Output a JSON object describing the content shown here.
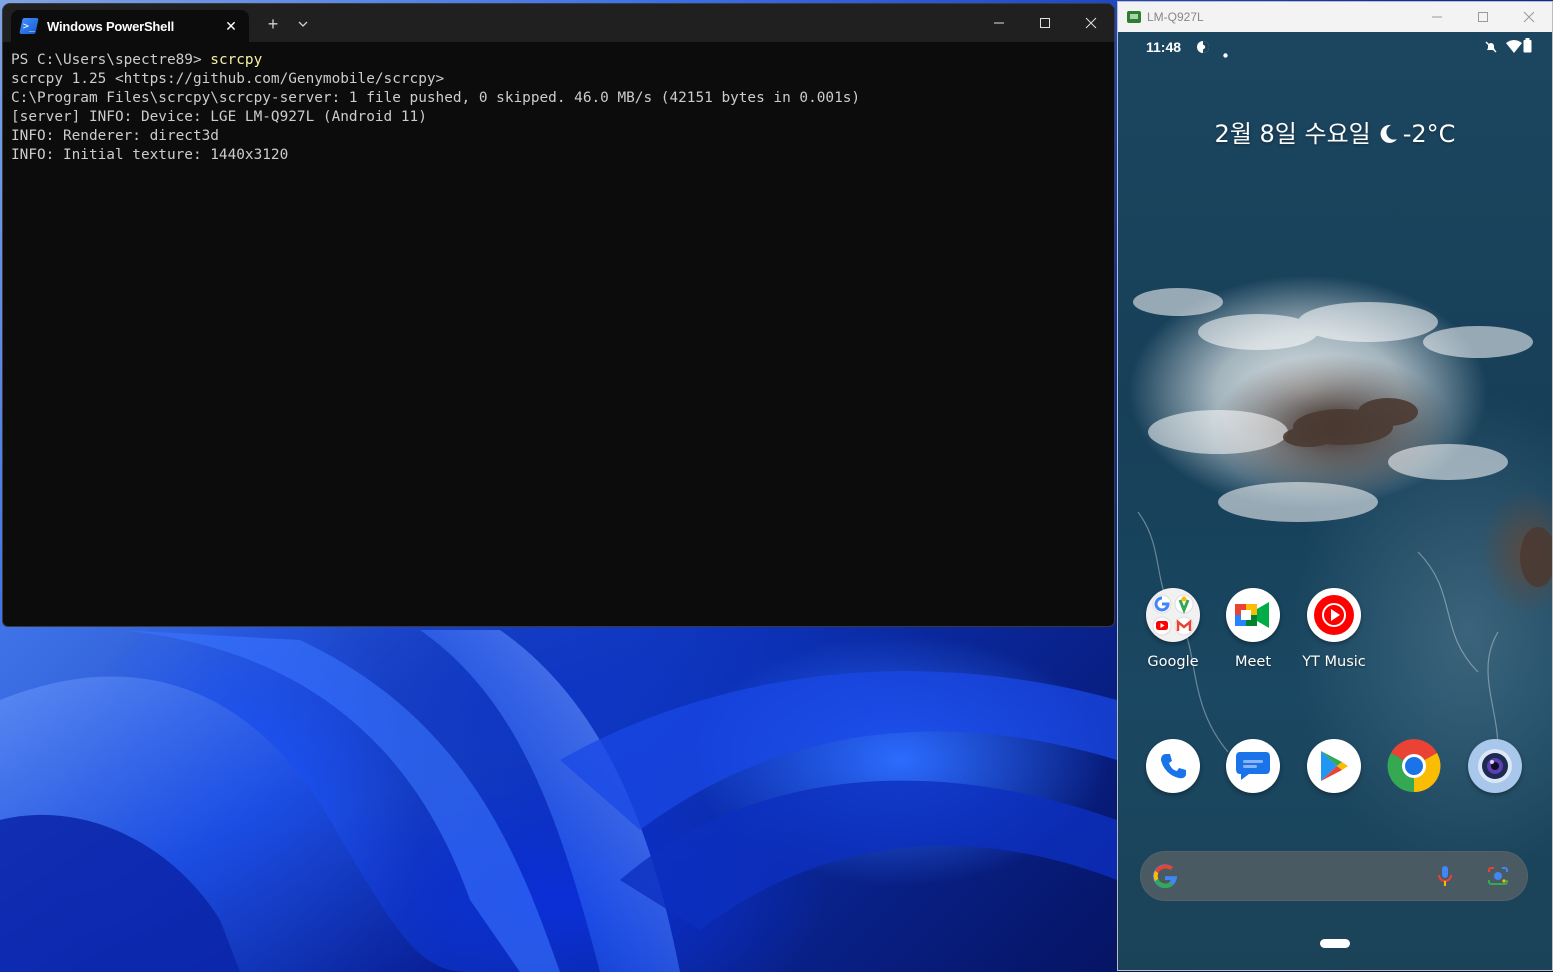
{
  "terminal": {
    "tab_title": "Windows PowerShell",
    "new_tab": "+",
    "lines": [
      {
        "prompt": "PS C:\\Users\\spectre89> ",
        "command": "scrcpy"
      },
      {
        "text": "scrcpy 1.25 <https://github.com/Genymobile/scrcpy>"
      },
      {
        "text": "C:\\Program Files\\scrcpy\\scrcpy-server: 1 file pushed, 0 skipped. 46.0 MB/s (42151 bytes in 0.001s)"
      },
      {
        "text": "[server] INFO: Device: LGE LM-Q927L (Android 11)"
      },
      {
        "text": "INFO: Renderer: direct3d"
      },
      {
        "text": "INFO: Initial texture: 1440x3120"
      }
    ]
  },
  "phone_window": {
    "title": "LM-Q927L",
    "status_bar": {
      "time": "11:48",
      "icons": [
        "data-saver-icon",
        "notification-dot-icon",
        "mute-icon",
        "wifi-icon",
        "battery-icon"
      ]
    },
    "glance": {
      "date": "2월 8일 수요일",
      "weather_icon": "moon-icon",
      "temperature": "-2°C"
    },
    "home_apps_row1": [
      {
        "label": "Google",
        "icon": "google-folder-icon"
      },
      {
        "label": "Meet",
        "icon": "meet-icon"
      },
      {
        "label": "YT Music",
        "icon": "yt-music-icon"
      }
    ],
    "dock_apps": [
      {
        "name": "Phone",
        "icon": "phone-icon"
      },
      {
        "name": "Messages",
        "icon": "messages-icon"
      },
      {
        "name": "Play Store",
        "icon": "play-store-icon"
      },
      {
        "name": "Chrome",
        "icon": "chrome-icon"
      },
      {
        "name": "Camera",
        "icon": "camera-icon"
      }
    ],
    "search_bar": {
      "icons": [
        "google-g-icon",
        "mic-icon",
        "lens-icon"
      ]
    }
  },
  "colors": {
    "terminal_bg": "#0c0c0c",
    "terminal_text": "#cccccc",
    "command_text": "#f9f1a5",
    "titlebar_bg": "#202020"
  }
}
